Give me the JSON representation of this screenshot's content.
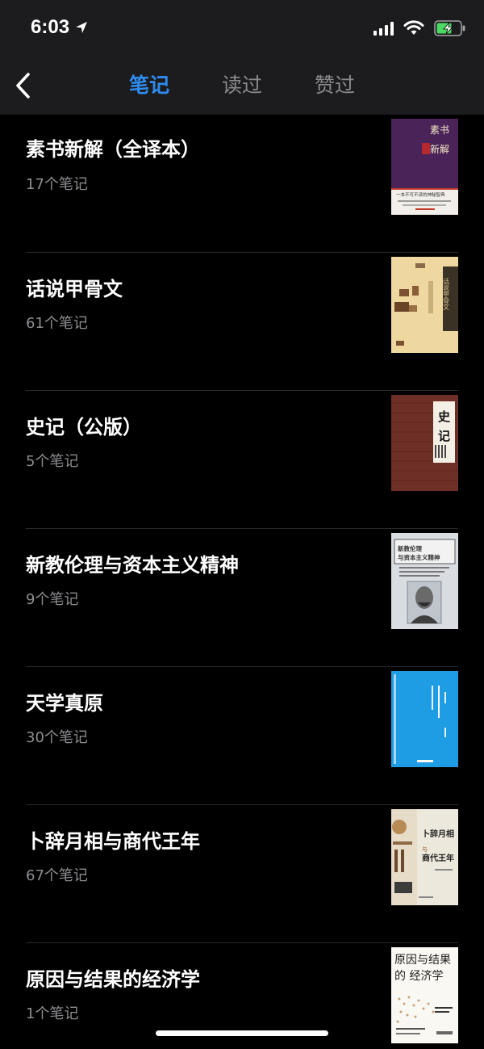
{
  "status": {
    "time": "6:03"
  },
  "nav": {
    "back_icon": "chevron-left-icon",
    "tabs": [
      {
        "label": "笔记",
        "active": true
      },
      {
        "label": "读过",
        "active": false
      },
      {
        "label": "赞过",
        "active": false
      }
    ]
  },
  "colors": {
    "accent": "#2e8cf0",
    "background": "#000000",
    "nav_background": "#1c1c1e",
    "secondary_text": "#8e8e93"
  },
  "books": [
    {
      "title": "素书新解（全译本）",
      "notes": "17个笔记",
      "cover": {
        "title": "素书新解",
        "tagline": "一本不可不读的神秘智典"
      }
    },
    {
      "title": "话说甲骨文",
      "notes": "61个笔记",
      "cover": {
        "title": "话说甲骨文"
      }
    },
    {
      "title": "史记（公版）",
      "notes": "5个笔记",
      "cover": {
        "title": "史记"
      }
    },
    {
      "title": "新教伦理与资本主义精神",
      "notes": "9个笔记",
      "cover": {
        "title": "新教伦理与资本主义精神",
        "subtitle": "Die protestantische Ethik und der Geist des Kapitalismus"
      }
    },
    {
      "title": "天学真原",
      "notes": "30个笔记",
      "cover": {
        "title": "天学真原"
      }
    },
    {
      "title": "卜辞月相与商代王年",
      "notes": "67个笔记",
      "cover": {
        "title": "卜辞月相与商代王年"
      }
    },
    {
      "title": "原因与结果的经济学",
      "notes": "1个笔记",
      "cover": {
        "title": "原因与结果的经济学"
      }
    }
  ]
}
